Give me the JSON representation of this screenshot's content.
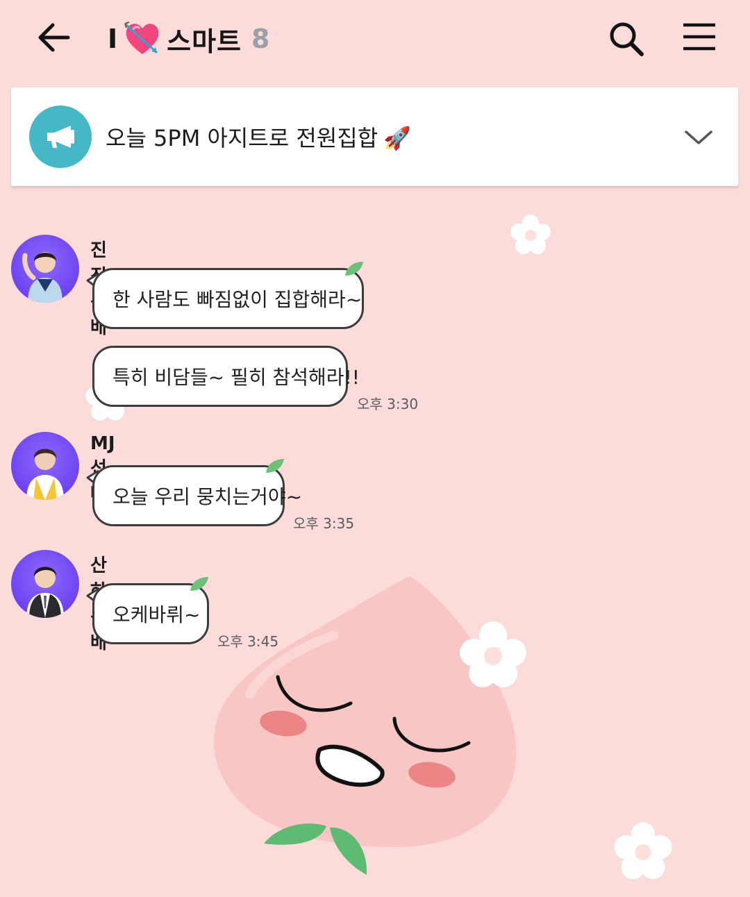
{
  "header": {
    "title_prefix": "I",
    "title_name": "스마트",
    "member_count": "8"
  },
  "notice": {
    "text": "오늘 5PM 아지트로 전원집합",
    "emoji": "🚀"
  },
  "messages": [
    {
      "sender": "진진선배",
      "bubbles": [
        {
          "text": "한 사람도 빠짐없이 집합해라~",
          "time": ""
        },
        {
          "text": "특히 비담들~ 필히 참석해라!!",
          "time": "오후 3:30"
        }
      ]
    },
    {
      "sender": "MJ선배",
      "bubbles": [
        {
          "text": "오늘 우리 뭉치는거야~",
          "time": "오후 3:35"
        }
      ]
    },
    {
      "sender": "산하선배",
      "bubbles": [
        {
          "text": "오케바뤼~",
          "time": "오후 3:45"
        }
      ]
    }
  ],
  "icons": {
    "back": "arrow-left-icon",
    "search": "search-icon",
    "menu": "hamburger-menu-icon",
    "notice": "megaphone-icon",
    "expand": "chevron-down-icon"
  },
  "colors": {
    "background": "#fbdcdb",
    "notice_icon": "#44b8c4",
    "bubble_border": "#3b3b3b",
    "leaf": "#6cc07a",
    "peach": "#f8c6c4"
  }
}
